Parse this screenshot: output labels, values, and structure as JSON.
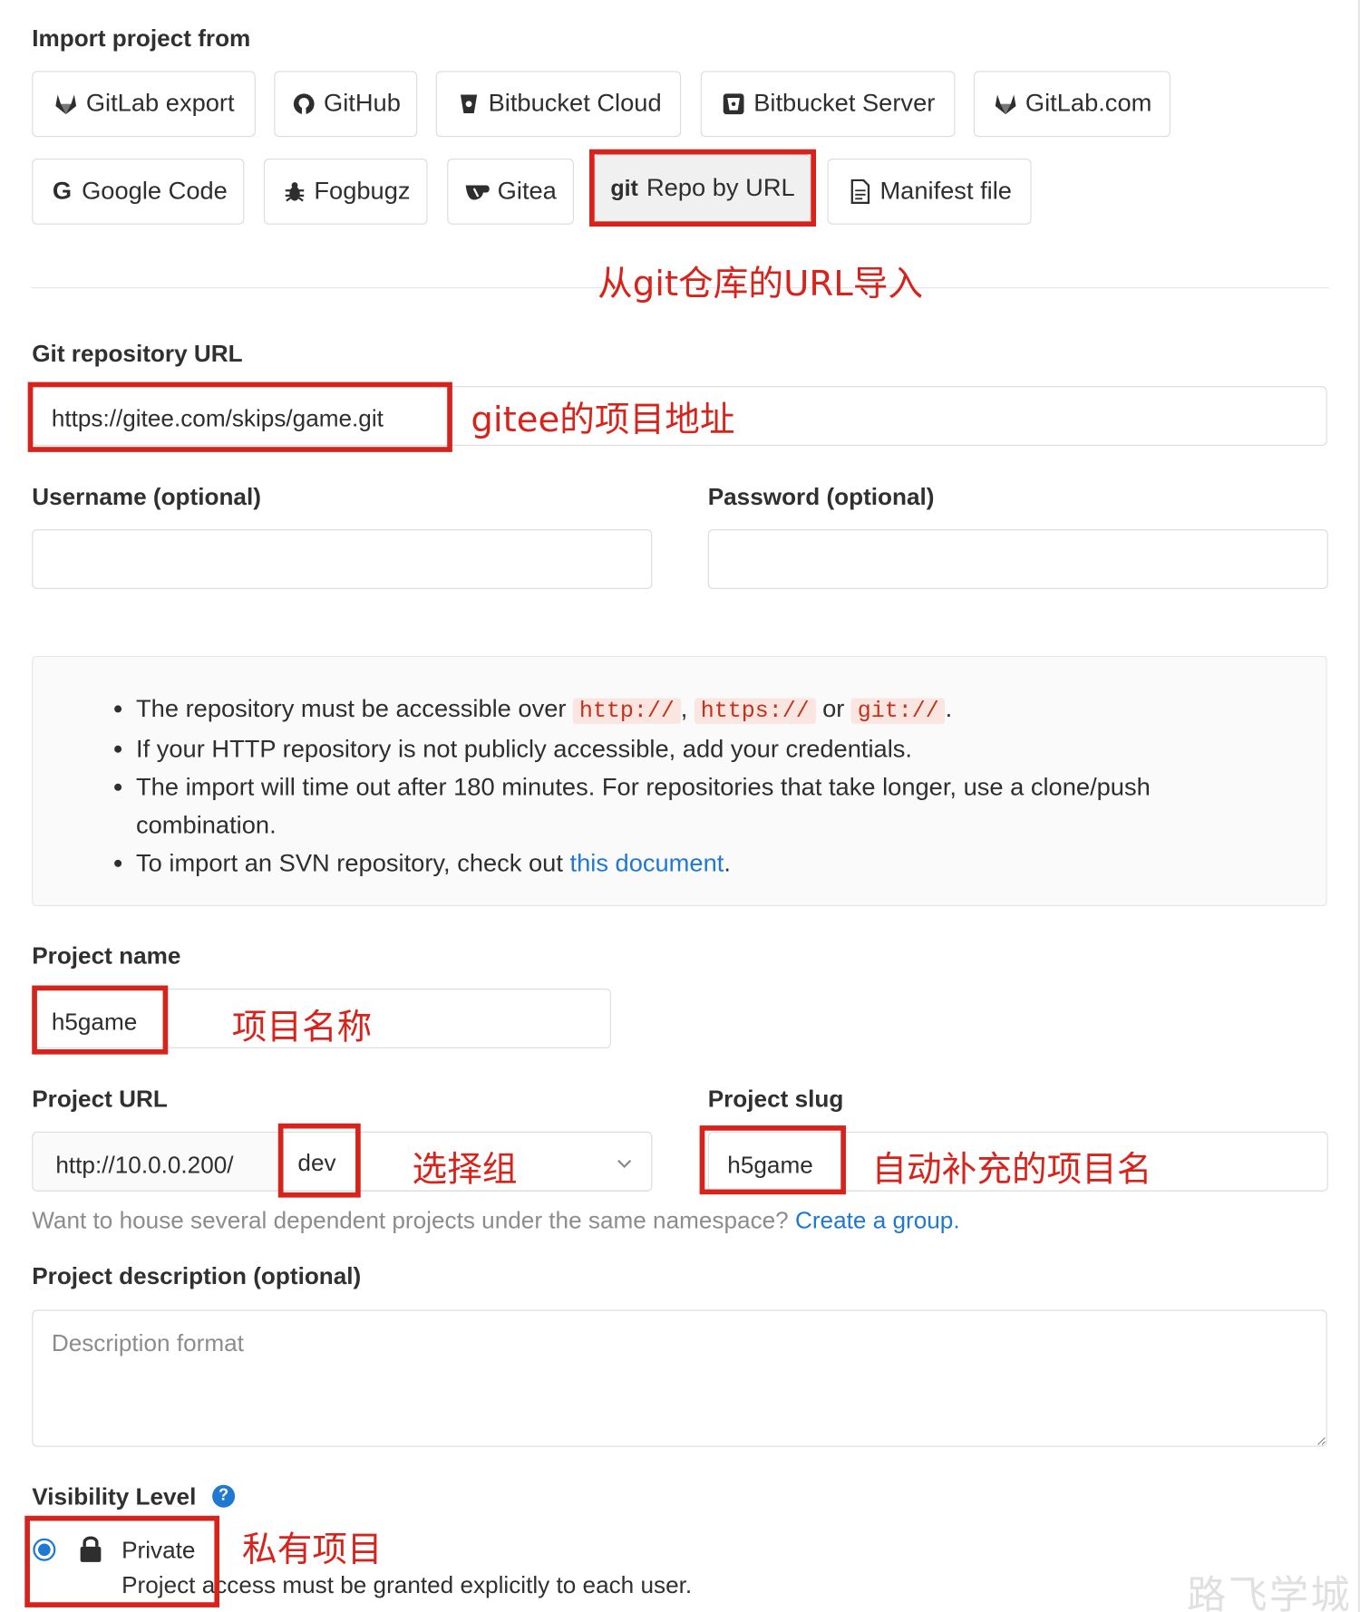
{
  "import": {
    "title": "Import project from",
    "sources": [
      {
        "label": "GitLab export",
        "icon": "gitlab-icon"
      },
      {
        "label": "GitHub",
        "icon": "github-icon"
      },
      {
        "label": "Bitbucket Cloud",
        "icon": "bitbucket-icon"
      },
      {
        "label": "Bitbucket Server",
        "icon": "bitbucket-server-icon"
      },
      {
        "label": "GitLab.com",
        "icon": "gitlab-icon"
      },
      {
        "label": "Google Code",
        "icon": "google-icon"
      },
      {
        "label": "Fogbugz",
        "icon": "bug-icon"
      },
      {
        "label": "Gitea",
        "icon": "gitea-icon"
      },
      {
        "label": "Repo by URL",
        "icon": "git-icon",
        "icon_text": "git",
        "selected": true
      },
      {
        "label": "Manifest file",
        "icon": "file-icon"
      }
    ]
  },
  "repo": {
    "label": "Git repository URL",
    "value": "https://gitee.com/skips/game.git",
    "username_label": "Username (optional)",
    "password_label": "Password (optional)",
    "username_value": "",
    "password_value": ""
  },
  "info": {
    "item1_pre": "The repository must be accessible over ",
    "protocols": [
      "http://",
      "https://",
      "git://"
    ],
    "sep1": ", ",
    "sep2": " or ",
    "item1_end": ".",
    "item2": "If your HTTP repository is not publicly accessible, add your credentials.",
    "item3": "The import will time out after 180 minutes. For repositories that take longer, use a clone/push combination.",
    "item4_pre": "To import an SVN repository, check out ",
    "item4_link": "this document",
    "item4_end": "."
  },
  "project": {
    "name_label": "Project name",
    "name_value": "h5game",
    "url_label": "Project URL",
    "url_prefix": "http://10.0.0.200/",
    "namespace": "dev",
    "slug_label": "Project slug",
    "slug_value": "h5game",
    "help_text": "Want to house several dependent projects under the same namespace?",
    "help_link": "Create a group.",
    "desc_label": "Project description (optional)",
    "desc_placeholder": "Description format",
    "visibility_label": "Visibility Level",
    "visibility_help": "?",
    "private_label": "Private",
    "private_desc": "Project access must be granted explicitly to each user."
  },
  "annotations": {
    "repo_by_url": "从git仓库的URL导入",
    "repo_url": "gitee的项目地址",
    "project_name": "项目名称",
    "group": "选择组",
    "slug": "自动补充的项目名",
    "private": "私有项目"
  },
  "watermark": "路飞学城",
  "colors": {
    "accent": "#1f78d1",
    "annotation_red": "#d6241d",
    "code_red": "#c0341d"
  }
}
